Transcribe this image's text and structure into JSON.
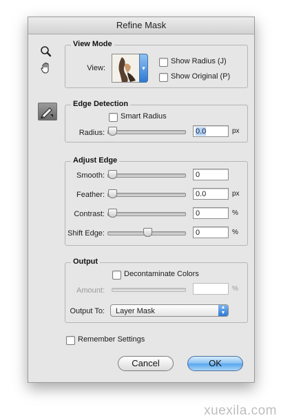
{
  "dialog": {
    "title": "Refine Mask"
  },
  "tools": {
    "zoom": "zoom-tool",
    "hand": "hand-tool",
    "refine_brush": "refine-radius-tool"
  },
  "view_mode": {
    "title": "View Mode",
    "view_label": "View:",
    "show_radius": "Show Radius (J)",
    "show_original": "Show Original (P)"
  },
  "edge_detection": {
    "title": "Edge Detection",
    "smart_radius": "Smart Radius",
    "radius_label": "Radius:",
    "radius_value": "0.0",
    "radius_unit": "px",
    "radius_level": 0
  },
  "adjust_edge": {
    "title": "Adjust Edge",
    "smooth_label": "Smooth:",
    "smooth_value": "0",
    "smooth_level": 0,
    "feather_label": "Feather:",
    "feather_value": "0.0",
    "feather_unit": "px",
    "feather_level": 0,
    "contrast_label": "Contrast:",
    "contrast_value": "0",
    "contrast_unit": "%",
    "contrast_level": 0,
    "shift_label": "Shift Edge:",
    "shift_value": "0",
    "shift_unit": "%",
    "shift_level": 0.5
  },
  "output": {
    "title": "Output",
    "decontaminate": "Decontaminate Colors",
    "amount_label": "Amount:",
    "amount_value": "",
    "amount_unit": "%",
    "output_to_label": "Output To:",
    "output_to_value": "Layer Mask"
  },
  "remember": "Remember Settings",
  "buttons": {
    "cancel": "Cancel",
    "ok": "OK"
  },
  "watermark": "xuexila.com",
  "colors": {
    "accent": "#5aa7ec",
    "selection": "#b5d5ff"
  }
}
